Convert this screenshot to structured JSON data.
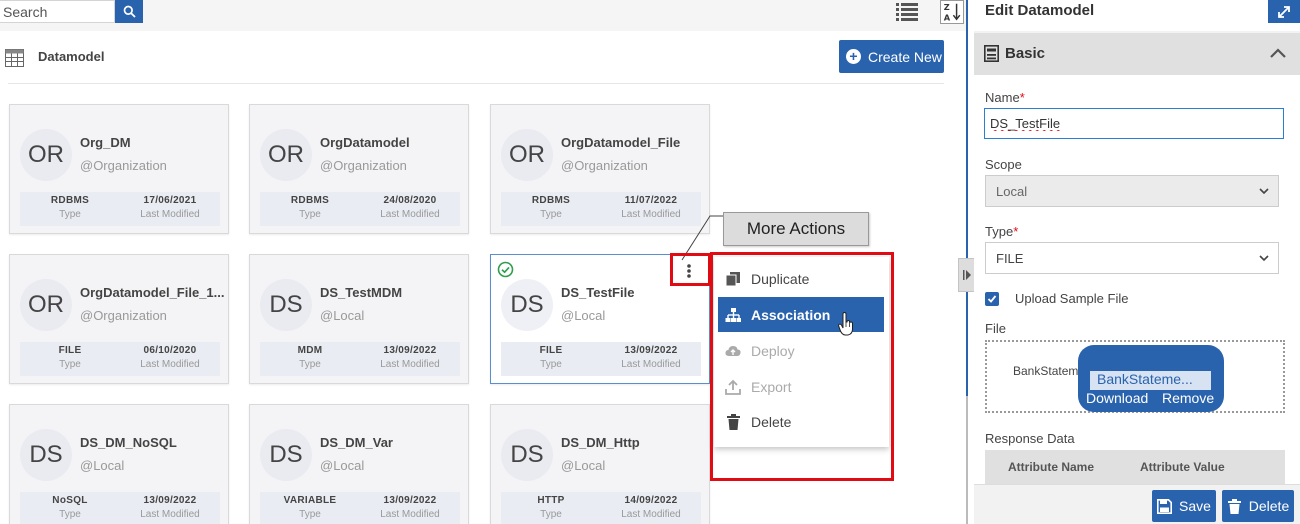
{
  "search": {
    "placeholder": "Search"
  },
  "page": {
    "title": "Datamodel",
    "create_label": "Create New"
  },
  "cards": [
    {
      "initials": "OR",
      "name": "Org_DM",
      "scope": "@Organization",
      "type": "RDBMS",
      "type_label": "Type",
      "modified": "17/06/2021",
      "modified_label": "Last Modified"
    },
    {
      "initials": "OR",
      "name": "OrgDatamodel",
      "scope": "@Organization",
      "type": "RDBMS",
      "type_label": "Type",
      "modified": "24/08/2020",
      "modified_label": "Last Modified"
    },
    {
      "initials": "OR",
      "name": "OrgDatamodel_File",
      "scope": "@Organization",
      "type": "RDBMS",
      "type_label": "Type",
      "modified": "11/07/2022",
      "modified_label": "Last Modified"
    },
    {
      "initials": "OR",
      "name": "OrgDatamodel_File_1...",
      "scope": "@Organization",
      "type": "FILE",
      "type_label": "Type",
      "modified": "06/10/2020",
      "modified_label": "Last Modified"
    },
    {
      "initials": "DS",
      "name": "DS_TestMDM",
      "scope": "@Local",
      "type": "MDM",
      "type_label": "Type",
      "modified": "13/09/2022",
      "modified_label": "Last Modified"
    },
    {
      "initials": "DS",
      "name": "DS_TestFile",
      "scope": "@Local",
      "type": "FILE",
      "type_label": "Type",
      "modified": "13/09/2022",
      "modified_label": "Last Modified"
    },
    {
      "initials": "DS",
      "name": "DS_DM_NoSQL",
      "scope": "@Local",
      "type": "NoSQL",
      "type_label": "Type",
      "modified": "13/09/2022",
      "modified_label": "Last Modified"
    },
    {
      "initials": "DS",
      "name": "DS_DM_Var",
      "scope": "@Local",
      "type": "VARIABLE",
      "type_label": "Type",
      "modified": "13/09/2022",
      "modified_label": "Last Modified"
    },
    {
      "initials": "DS",
      "name": "DS_DM_Http",
      "scope": "@Local",
      "type": "HTTP",
      "type_label": "Type",
      "modified": "14/09/2022",
      "modified_label": "Last Modified"
    }
  ],
  "callout": {
    "text": "More Actions"
  },
  "menu": {
    "items": [
      {
        "label": "Duplicate",
        "icon": "duplicate-icon",
        "state": "normal"
      },
      {
        "label": "Association",
        "icon": "association-icon",
        "state": "active"
      },
      {
        "label": "Deploy",
        "icon": "deploy-icon",
        "state": "disabled"
      },
      {
        "label": "Export",
        "icon": "export-icon",
        "state": "disabled"
      },
      {
        "label": "Delete",
        "icon": "trash-icon",
        "state": "normal"
      }
    ]
  },
  "panel": {
    "title": "Edit Datamodel",
    "section": "Basic",
    "name_label": "Name",
    "name_value": "DS_TestFile",
    "scope_label": "Scope",
    "scope_value": "Local",
    "type_label": "Type",
    "type_value": "FILE",
    "upload_label": "Upload Sample File",
    "upload_checked": true,
    "file_label": "File",
    "file_name_bg": "BankStatem",
    "file_tip_name": "BankStateme...",
    "download_label": "Download",
    "remove_label": "Remove",
    "response_label": "Response Data",
    "attr_name_header": "Attribute Name",
    "attr_value_header": "Attribute Value",
    "save_label": "Save",
    "delete_label": "Delete"
  },
  "colors": {
    "accent": "#2a63ad",
    "annotation": "#e10b14",
    "success": "#2e9e4f"
  }
}
